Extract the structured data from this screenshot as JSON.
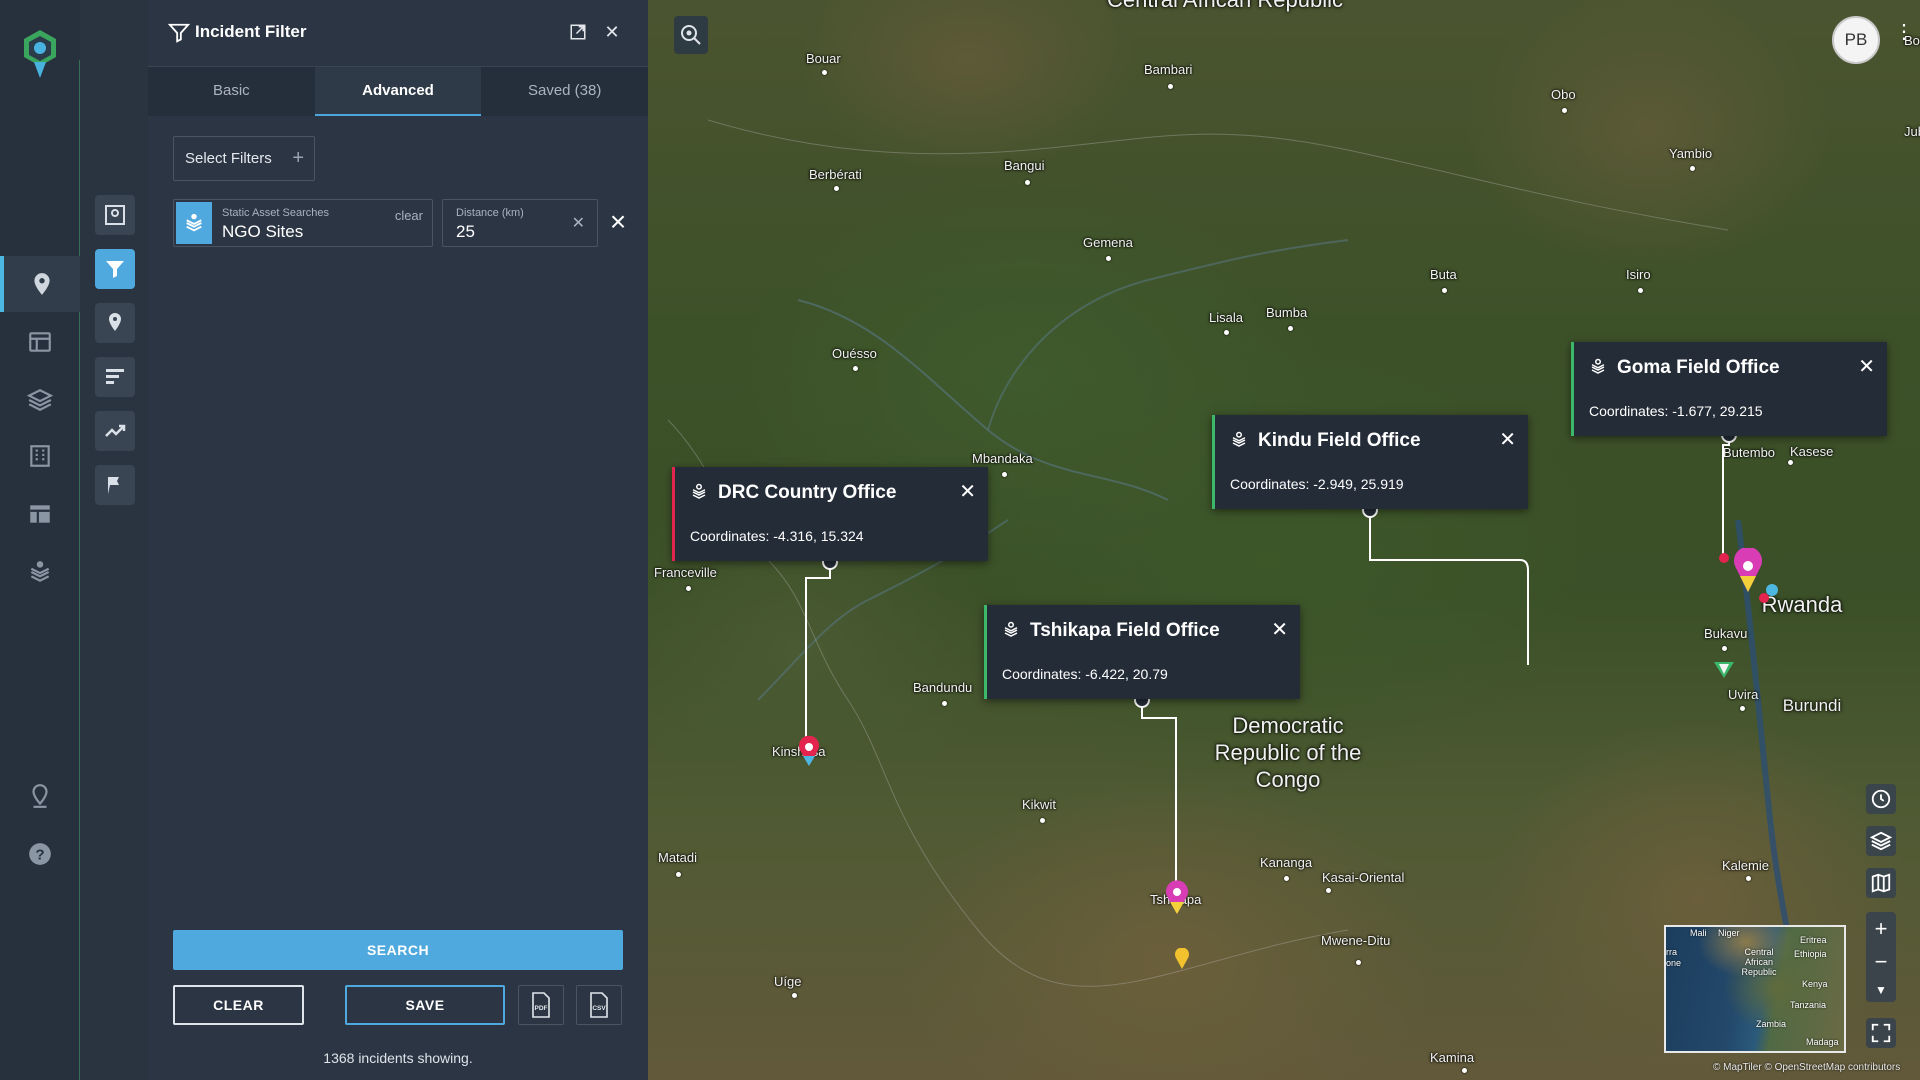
{
  "app": {
    "logo": "app-logo",
    "avatar_initials": "PB"
  },
  "rail_main": {
    "items": [
      {
        "name": "map-pin-icon",
        "active": true
      },
      {
        "name": "dashboard-icon",
        "active": false
      },
      {
        "name": "layers-icon",
        "active": false
      },
      {
        "name": "buildings-icon",
        "active": false
      },
      {
        "name": "table-icon",
        "active": false
      },
      {
        "name": "asset-stack-icon",
        "active": false
      }
    ],
    "bottom": [
      {
        "name": "location-settings-icon"
      },
      {
        "name": "help-icon"
      }
    ]
  },
  "rail_tools": {
    "items": [
      {
        "name": "map-search-icon",
        "active": false
      },
      {
        "name": "incident-filter-icon",
        "active": true
      },
      {
        "name": "location-pin-icon",
        "active": false
      },
      {
        "name": "sort-bars-icon",
        "active": false
      },
      {
        "name": "trend-icon",
        "active": false
      },
      {
        "name": "region-flag-icon",
        "active": false
      }
    ]
  },
  "panel": {
    "title": "Incident Filter",
    "tabs": [
      {
        "label": "Basic",
        "active": false
      },
      {
        "label": "Advanced",
        "active": true
      },
      {
        "label": "Saved (38)",
        "active": false
      }
    ],
    "select_filters_label": "Select Filters",
    "asset_search": {
      "label": "Static Asset Searches",
      "value": "NGO Sites",
      "clear_label": "clear"
    },
    "distance": {
      "label": "Distance (km)",
      "value": "25"
    },
    "search_label": "SEARCH",
    "clear_label": "CLEAR",
    "save_label": "SAVE",
    "export_pdf_label": "PDF",
    "export_csv_label": "CSV",
    "status": "1368 incidents showing."
  },
  "map": {
    "places": [
      {
        "name": "Bouar"
      },
      {
        "name": "Bambari"
      },
      {
        "name": "Obo"
      },
      {
        "name": "Yambio"
      },
      {
        "name": "Berbérati"
      },
      {
        "name": "Bangui"
      },
      {
        "name": "Gemena"
      },
      {
        "name": "Buta"
      },
      {
        "name": "Isiro"
      },
      {
        "name": "Lisala"
      },
      {
        "name": "Bumba"
      },
      {
        "name": "Ouésso"
      },
      {
        "name": "Mbandaka"
      },
      {
        "name": "Franceville"
      },
      {
        "name": "Bandundu"
      },
      {
        "name": "Kikwit"
      },
      {
        "name": "Kananga"
      },
      {
        "name": "Kasai-Oriental"
      },
      {
        "name": "Mwene-Ditu"
      },
      {
        "name": "Matadi"
      },
      {
        "name": "Uíge"
      },
      {
        "name": "Kamina"
      },
      {
        "name": "Kalemie"
      },
      {
        "name": "Uvira"
      },
      {
        "name": "Bukavu"
      },
      {
        "name": "Butembo"
      },
      {
        "name": "Kasese"
      },
      {
        "name": "Kinshasa"
      },
      {
        "name": "Tshikapa"
      },
      {
        "name": "Jub"
      },
      {
        "name": "Bor"
      }
    ],
    "countries": [
      {
        "name": "Central African Republic"
      },
      {
        "name": "Democratic Republic of the Congo"
      },
      {
        "name": "Rwanda"
      },
      {
        "name": "Burundi"
      }
    ],
    "popups": [
      {
        "title": "DRC Country Office",
        "coords": "Coordinates: -4.316, 15.324",
        "accent": "#e3244f"
      },
      {
        "title": "Tshikapa Field Office",
        "coords": "Coordinates: -6.422, 20.79",
        "accent": "#3bb86a"
      },
      {
        "title": "Kindu Field Office",
        "coords": "Coordinates: -2.949, 25.919",
        "accent": "#3bb86a"
      },
      {
        "title": "Goma Field Office",
        "coords": "Coordinates: -1.677, 29.215",
        "accent": "#3bb86a"
      }
    ],
    "controls": [
      {
        "name": "history-clock-icon"
      },
      {
        "name": "map-layers-icon"
      },
      {
        "name": "basemap-icon"
      },
      {
        "name": "zoom-in-icon"
      },
      {
        "name": "zoom-out-icon"
      },
      {
        "name": "compass-icon"
      },
      {
        "name": "fullscreen-icon"
      }
    ],
    "minimap": {
      "labels": [
        "Mali",
        "Niger",
        "Eritrea",
        "Central African Republic",
        "Ethiopia",
        "Kenya",
        "Tanzania",
        "Zambia",
        "Madaga",
        "rra",
        "one"
      ]
    },
    "attribution": "© MapTiler © OpenStreetMap contributors"
  }
}
